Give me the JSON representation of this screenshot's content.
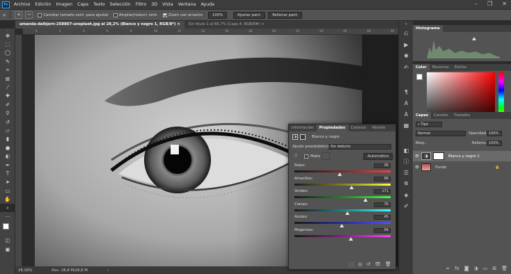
{
  "menu": {
    "items": [
      "Archivo",
      "Edición",
      "Imagen",
      "Capa",
      "Texto",
      "Selección",
      "Filtro",
      "3D",
      "Vista",
      "Ventana",
      "Ayuda"
    ],
    "window_controls": [
      "–",
      "❐",
      "✕"
    ]
  },
  "options_bar": {
    "check_resize": "Cambiar tamaño vent. para ajustar",
    "check_zoom_all": "Ampliar/reducir vent.",
    "check_scrubby": "Zoom con arrastre",
    "zoom_value": "100%",
    "fit_screen": "Ajustar pant.",
    "fill_screen": "Rellenar pant."
  },
  "tabs": [
    {
      "label": "amanda-dalbjorn-258807-unsplash.jpg al 28,2% (Blanco y negro 1, RGB/8*)",
      "close": "×"
    },
    {
      "label": "Sin título-1 al 66,7% (Capa 4, RGB/8#)",
      "close": "×"
    }
  ],
  "ruler": {
    "top": [
      "0",
      "2",
      "4",
      "6",
      "8",
      "10",
      "12",
      "14",
      "16",
      "18",
      "20",
      "22",
      "24",
      "26",
      "28",
      "30"
    ]
  },
  "status": {
    "zoom": "28,16%",
    "doc": "Doc: 28,8 M/28,8 M",
    "arrow": "›"
  },
  "histogram": {
    "title": "Histograma"
  },
  "color_panel": {
    "tabs": [
      "Color",
      "Muestras",
      "Estilos"
    ]
  },
  "layers_panel": {
    "tabs": [
      "Capas",
      "Canales",
      "Trazados"
    ],
    "filter": "Tipo",
    "blend_mode": "Normal",
    "opacity_label": "Opacidad:",
    "opacity": "100%",
    "lock_label": "Bloq.:",
    "fill_label": "Relleno:",
    "fill": "100%",
    "layers": [
      {
        "name": "Blanco y negro 1",
        "selected": true
      },
      {
        "name": "Fondo",
        "selected": false
      }
    ]
  },
  "properties": {
    "tabs": [
      "Información",
      "Propiedades",
      "Carácter",
      "Párrafo"
    ],
    "title": "Blanco y negro",
    "preset_label": "Ajuste preestablecido:",
    "preset_value": "Por defecto",
    "tint_label": "Matiz",
    "auto_label": "Automático",
    "sliders": [
      {
        "label": "Rojos:",
        "value": 36,
        "gradient": [
          "#1a1a1a",
          "#7a2a2a",
          "#ff3a3a"
        ]
      },
      {
        "label": "Amarillos:",
        "value": 96,
        "gradient": [
          "#1a1a1a",
          "#808020",
          "#ffff40"
        ]
      },
      {
        "label": "Verdes:",
        "value": 171,
        "gradient": [
          "#1a1a1a",
          "#2a802a",
          "#40ff40"
        ]
      },
      {
        "label": "Cianes:",
        "value": 76,
        "gradient": [
          "#1a1a1a",
          "#208080",
          "#40ffff"
        ]
      },
      {
        "label": "Azules:",
        "value": 45,
        "gradient": [
          "#1a1a1a",
          "#2a2a9a",
          "#5050ff"
        ]
      },
      {
        "label": "Magentas:",
        "value": 94,
        "gradient": [
          "#1a1a1a",
          "#802080",
          "#ff40ff"
        ]
      }
    ],
    "slider_range": [
      -200,
      300
    ]
  },
  "colors": {
    "accent": "#31a8ff",
    "panel_bg": "#535353",
    "selected_layer": "#6a6a6a"
  },
  "icons": {
    "tools": [
      "move-icon",
      "artboard-icon",
      "lasso-icon",
      "quick-select-icon",
      "crop-icon",
      "eyedropper-icon",
      "healing-brush-icon",
      "brush-icon",
      "clone-stamp-icon",
      "history-brush-icon",
      "eraser-icon",
      "gradient-icon",
      "blur-icon",
      "dodge-icon",
      "pen-icon",
      "type-icon",
      "path-select-icon",
      "rectangle-icon",
      "hand-icon",
      "zoom-icon",
      "more-tools-icon"
    ]
  }
}
